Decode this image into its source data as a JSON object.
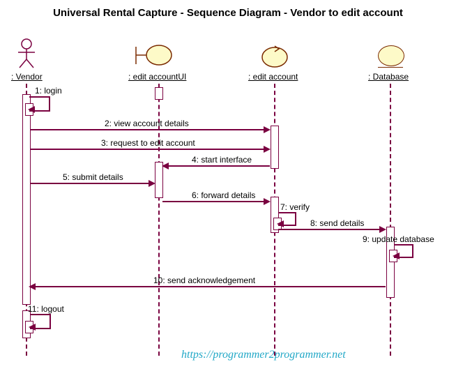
{
  "title": "Universal Rental Capture - Sequence Diagram - Vendor to edit account",
  "participants": {
    "vendor": ": Vendor",
    "ui": ": edit accountUI",
    "controller": ": edit account",
    "db": ": Database"
  },
  "messages": {
    "m1": "1: login",
    "m2": "2: view account details",
    "m3": "3: request to edit account",
    "m4": "4: start interface",
    "m5": "5: submit details",
    "m6": "6: forward details",
    "m7": "7: verify",
    "m8": "8: send details",
    "m9": "9: update database",
    "m10": "10: send acknowledgement",
    "m11": "11: logout"
  },
  "watermark": "https://programmer2programmer.net"
}
